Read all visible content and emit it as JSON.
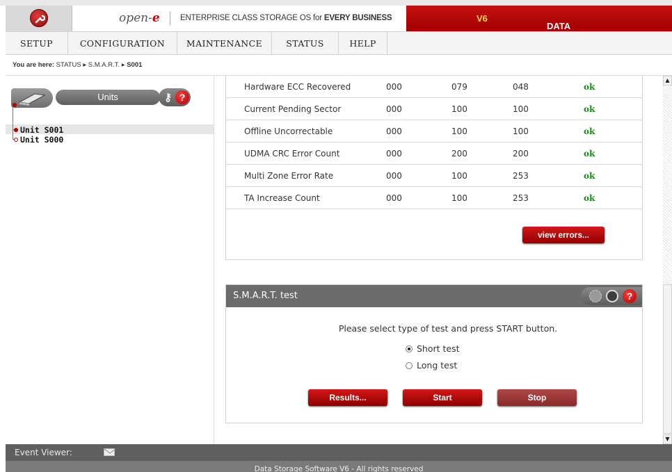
{
  "header": {
    "brand_prefix": "open-",
    "brand_suffix": "e",
    "tagline_prefix": "ENTERPRISE CLASS STORAGE OS for ",
    "tagline_bold": "EVERY BUSINESS",
    "product": "DATA STORAGE SOFTWARE ",
    "product_version": "V6"
  },
  "menu": [
    "SETUP",
    "CONFIGURATION",
    "MAINTENANCE",
    "STATUS",
    "HELP"
  ],
  "breadcrumb": {
    "label": "You are here:",
    "path": " STATUS ▸ S.M.A.R.T. ▸ ",
    "current": "S001"
  },
  "sidebar": {
    "title": "Units",
    "units": [
      "Unit S001",
      "Unit S000"
    ]
  },
  "smart_table": {
    "rows": [
      {
        "attr": "Hardware ECC Recovered",
        "threshold": "000",
        "value": "079",
        "worst": "048",
        "status": "ok"
      },
      {
        "attr": "Current Pending Sector",
        "threshold": "000",
        "value": "100",
        "worst": "100",
        "status": "ok"
      },
      {
        "attr": "Offline Uncorrectable",
        "threshold": "000",
        "value": "100",
        "worst": "100",
        "status": "ok"
      },
      {
        "attr": "UDMA CRC Error Count",
        "threshold": "000",
        "value": "200",
        "worst": "200",
        "status": "ok"
      },
      {
        "attr": "Multi Zone Error Rate",
        "threshold": "000",
        "value": "100",
        "worst": "253",
        "status": "ok"
      },
      {
        "attr": "TA Increase Count",
        "threshold": "000",
        "value": "100",
        "worst": "253",
        "status": "ok"
      }
    ],
    "view_errors_label": "view errors..."
  },
  "smart_test": {
    "title": "S.M.A.R.T. test",
    "message": "Please select type of test and press START button.",
    "options": [
      "Short test",
      "Long test"
    ],
    "selected": "Short test",
    "buttons": {
      "results": "Results...",
      "start": "Start",
      "stop": "Stop"
    }
  },
  "footer": {
    "event_viewer": "Event Viewer:",
    "copyright": "Data Storage Software V6 - All rights reserved"
  },
  "colors": {
    "brand_red": "#b00000",
    "ok_green": "#1b8a1b",
    "header_gray": "#6b6b6b"
  }
}
